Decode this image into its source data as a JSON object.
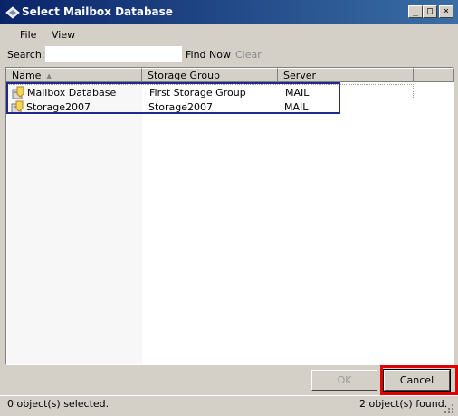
{
  "window": {
    "title": "Select Mailbox Database",
    "caption_buttons": {
      "minimize": "_",
      "maximize": "□",
      "close": "×"
    }
  },
  "menu": {
    "file": "File",
    "view": "View"
  },
  "search": {
    "label": "Search:",
    "value": "",
    "find_now": "Find Now",
    "clear": "Clear"
  },
  "list": {
    "columns": [
      "Name",
      "Storage Group",
      "Server"
    ],
    "sorted_column": "Name",
    "rows": [
      {
        "name": "Mailbox Database",
        "storage_group": "First Storage Group",
        "server": "MAIL",
        "icon": "mailbox-database-icon"
      },
      {
        "name": "Storage2007",
        "storage_group": "Storage2007",
        "server": "MAIL",
        "icon": "mailbox-database-icon"
      }
    ]
  },
  "buttons": {
    "ok": "OK",
    "cancel": "Cancel"
  },
  "status": {
    "selected": "0 object(s) selected.",
    "found": "2 object(s) found."
  },
  "colors": {
    "titlebar": "#0a246a",
    "row_highlight_border": "#1f2a8c",
    "cancel_highlight_border": "#e00000"
  }
}
